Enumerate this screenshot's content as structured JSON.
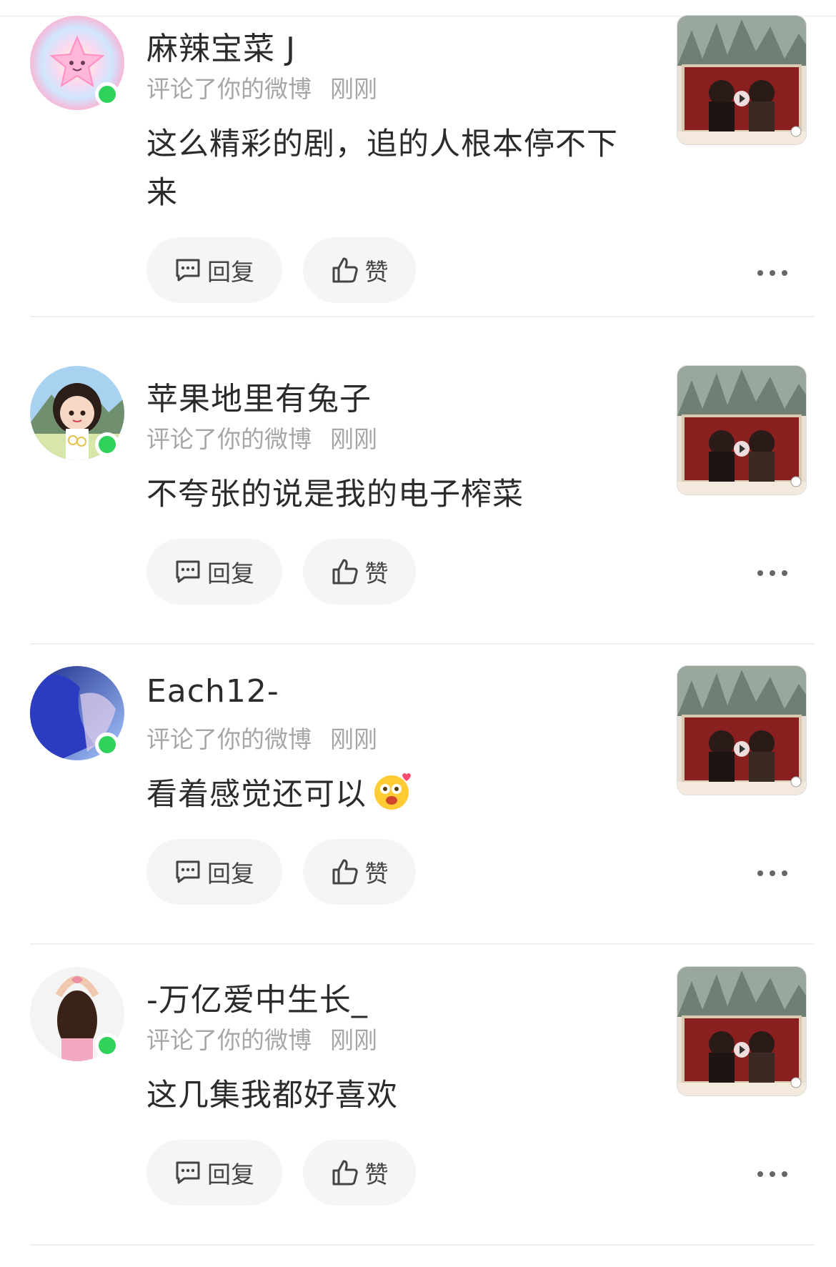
{
  "labels": {
    "action": "评论了你的微博",
    "reply": "回复",
    "like": "赞"
  },
  "notifications": [
    {
      "user": "麻辣宝菜 J",
      "time": "刚刚",
      "content": "这么精彩的剧，追的人根本停不下来",
      "avatar": "star-avatar"
    },
    {
      "user": "苹果地里有兔子",
      "time": "刚刚",
      "content": "不夸张的说是我的电子榨菜",
      "avatar": "girl-flowers-avatar"
    },
    {
      "user": "Each12-",
      "time": "刚刚",
      "content": "看着感觉还可以",
      "avatar": "blue-hair-avatar"
    },
    {
      "user": "-万亿爱中生长_",
      "time": "刚刚",
      "content": "这几集我都好喜欢",
      "avatar": "heart-hands-avatar"
    }
  ],
  "colors": {
    "online": "#2fd25a",
    "meta": "#a6a6a6",
    "button_bg": "#f5f5f5"
  }
}
